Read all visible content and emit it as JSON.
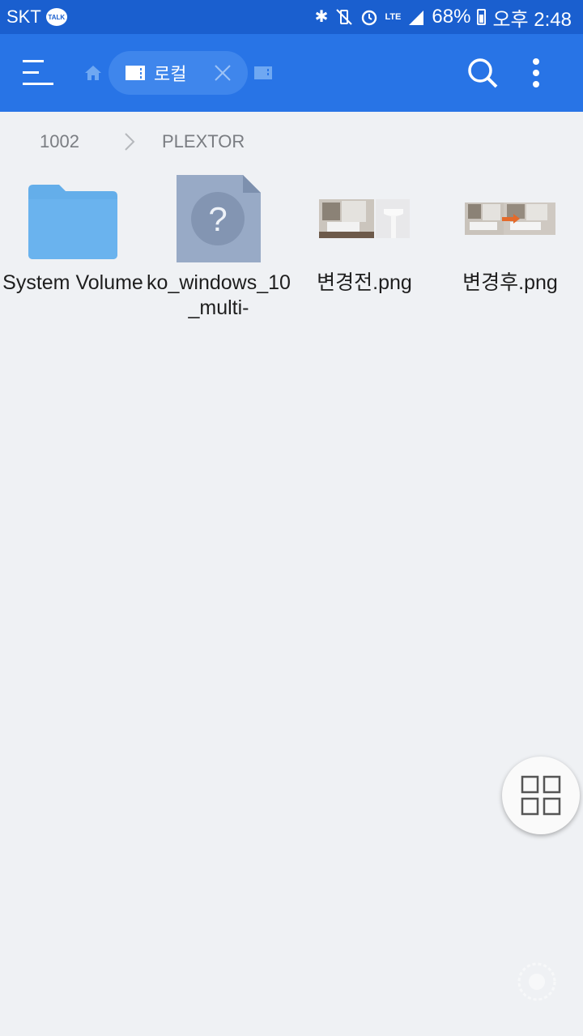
{
  "status_bar": {
    "carrier": "SKT",
    "talk_badge": "TALK",
    "network": "LTE",
    "battery": "68%",
    "time": "오후 2:48",
    "icons": [
      "bluetooth-icon",
      "vibrate-mute-icon",
      "alarm-icon",
      "signal-icon",
      "battery-icon"
    ]
  },
  "toolbar": {
    "tab_label": "로컬",
    "icons": [
      "menu-icon",
      "home-icon",
      "storage-icon",
      "close-icon",
      "search-icon",
      "more-icon"
    ]
  },
  "breadcrumb": {
    "items": [
      "1002",
      "PLEXTOR"
    ]
  },
  "files": [
    {
      "name": "System Volume",
      "type": "folder"
    },
    {
      "name": "ko_windows_10_multi-",
      "type": "unknown"
    },
    {
      "name": "변경전.png",
      "type": "image"
    },
    {
      "name": "변경후.png",
      "type": "image"
    }
  ],
  "colors": {
    "status_bar": "#1a5fcf",
    "toolbar": "#2874e6",
    "background": "#eff1f4",
    "folder": "#64aeea"
  }
}
